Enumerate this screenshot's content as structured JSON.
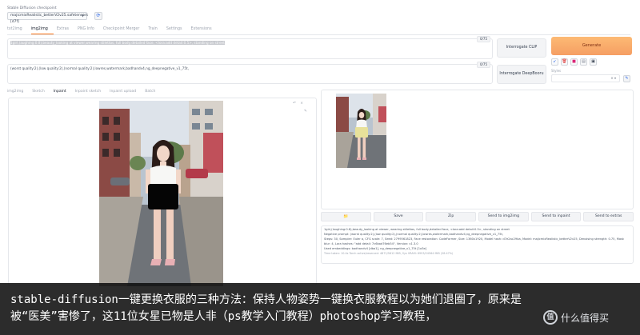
{
  "checkpoint": {
    "label": "Stable Diffusion checkpoint",
    "value": "majicmixRealistic_betterV2v25.safetensors [d7f]",
    "refresh_icon": "refresh-icon"
  },
  "main_tabs": [
    {
      "label": "txt2img",
      "active": false
    },
    {
      "label": "img2img",
      "active": true
    },
    {
      "label": "Extras",
      "active": false
    },
    {
      "label": "PNG Info",
      "active": false
    },
    {
      "label": "Checkpoint Merger",
      "active": false
    },
    {
      "label": "Train",
      "active": false
    },
    {
      "label": "Settings",
      "active": false
    },
    {
      "label": "Extensions",
      "active": false
    }
  ],
  "prompt": {
    "positive": "1girl,(aughing:0.8),beauty_looking at viewer,wearing stilettos, full body,detailed face, <lora:add detail:0.5>, standing on street",
    "positive_tokens": "0/75",
    "negative": "(worst quality:2),(low quality:2),(normal quality:2),lowres,watermark,badhandv4,ng_deepnegative_v1_75t,",
    "negative_tokens": "0/75"
  },
  "interrogate": {
    "clip_label": "Interrogate CLIP",
    "deepbooru_label": "Interrogate DeepBooru"
  },
  "generate": {
    "label": "Generate",
    "tools": [
      "arrow-icon",
      "trash-icon",
      "palette-icon",
      "clipboard-icon",
      "save-icon"
    ],
    "styles_label": "Styles",
    "styles_value": "× ▾",
    "styles_btn_icon": "edit-icon"
  },
  "sub_tabs": [
    {
      "label": "img2img",
      "active": false
    },
    {
      "label": "Sketch",
      "active": false
    },
    {
      "label": "Inpaint",
      "active": true
    },
    {
      "label": "Inpaint sketch",
      "active": false
    },
    {
      "label": "Inpaint upload",
      "active": false
    },
    {
      "label": "Batch",
      "active": false
    }
  ],
  "canvas": {
    "controls_top": "↶ ×",
    "controls_side": "✎"
  },
  "actions": [
    {
      "label": "📁",
      "icon": "folder-icon"
    },
    {
      "label": "Save"
    },
    {
      "label": "Zip"
    },
    {
      "label": "Send to img2img"
    },
    {
      "label": "Send to inpaint"
    },
    {
      "label": "Send to extras"
    }
  ],
  "generation_info": {
    "line1": "1girl,(laughing:0.8),beauty_looking at viewer, wearing stilettos, full body,detailed face, <lora:add detail:0.5>, standing on street",
    "line2": "Negative prompt: (worst quality:2),(low quality:2),(normal quality:2),lowres,watermark,badhandv4,ng_deepnegative_v1_75t,",
    "line3": "Steps: 30, Sampler: Euler a, CFG scale: 7, Seed: 2799561823, Face restoration: CodeFormer, Size: 1360x1920, Model hash: d7e2ac29ba, Model: majicmixRealistic_betterV2v25, Denoising strength: 0.75, Mask blur: 4, Lora hashes: \"add detail: 7c6bad76eb54\", Version: v1.3.0",
    "line4": "Used embeddings: badhandv4 [dba1], ng_deepnegative_v1_75t [1a3e]",
    "time": "Time taken: 10.4s  Torch active/reserved: 4871/5612 MiB, Sys VRAM: 6993/24564 MiB (28.47%)"
  },
  "caption": {
    "line1": "stable-diffusion一键更换衣服的三种方法：保持人物姿势一键换衣服教程以为她们退圈了，原来是",
    "line2": "被“医美”害惨了，这11位女星已物是人非（ps教学入门教程）photoshop学习教程，"
  },
  "watermark": {
    "logo": "值",
    "text": "什么值得买"
  }
}
